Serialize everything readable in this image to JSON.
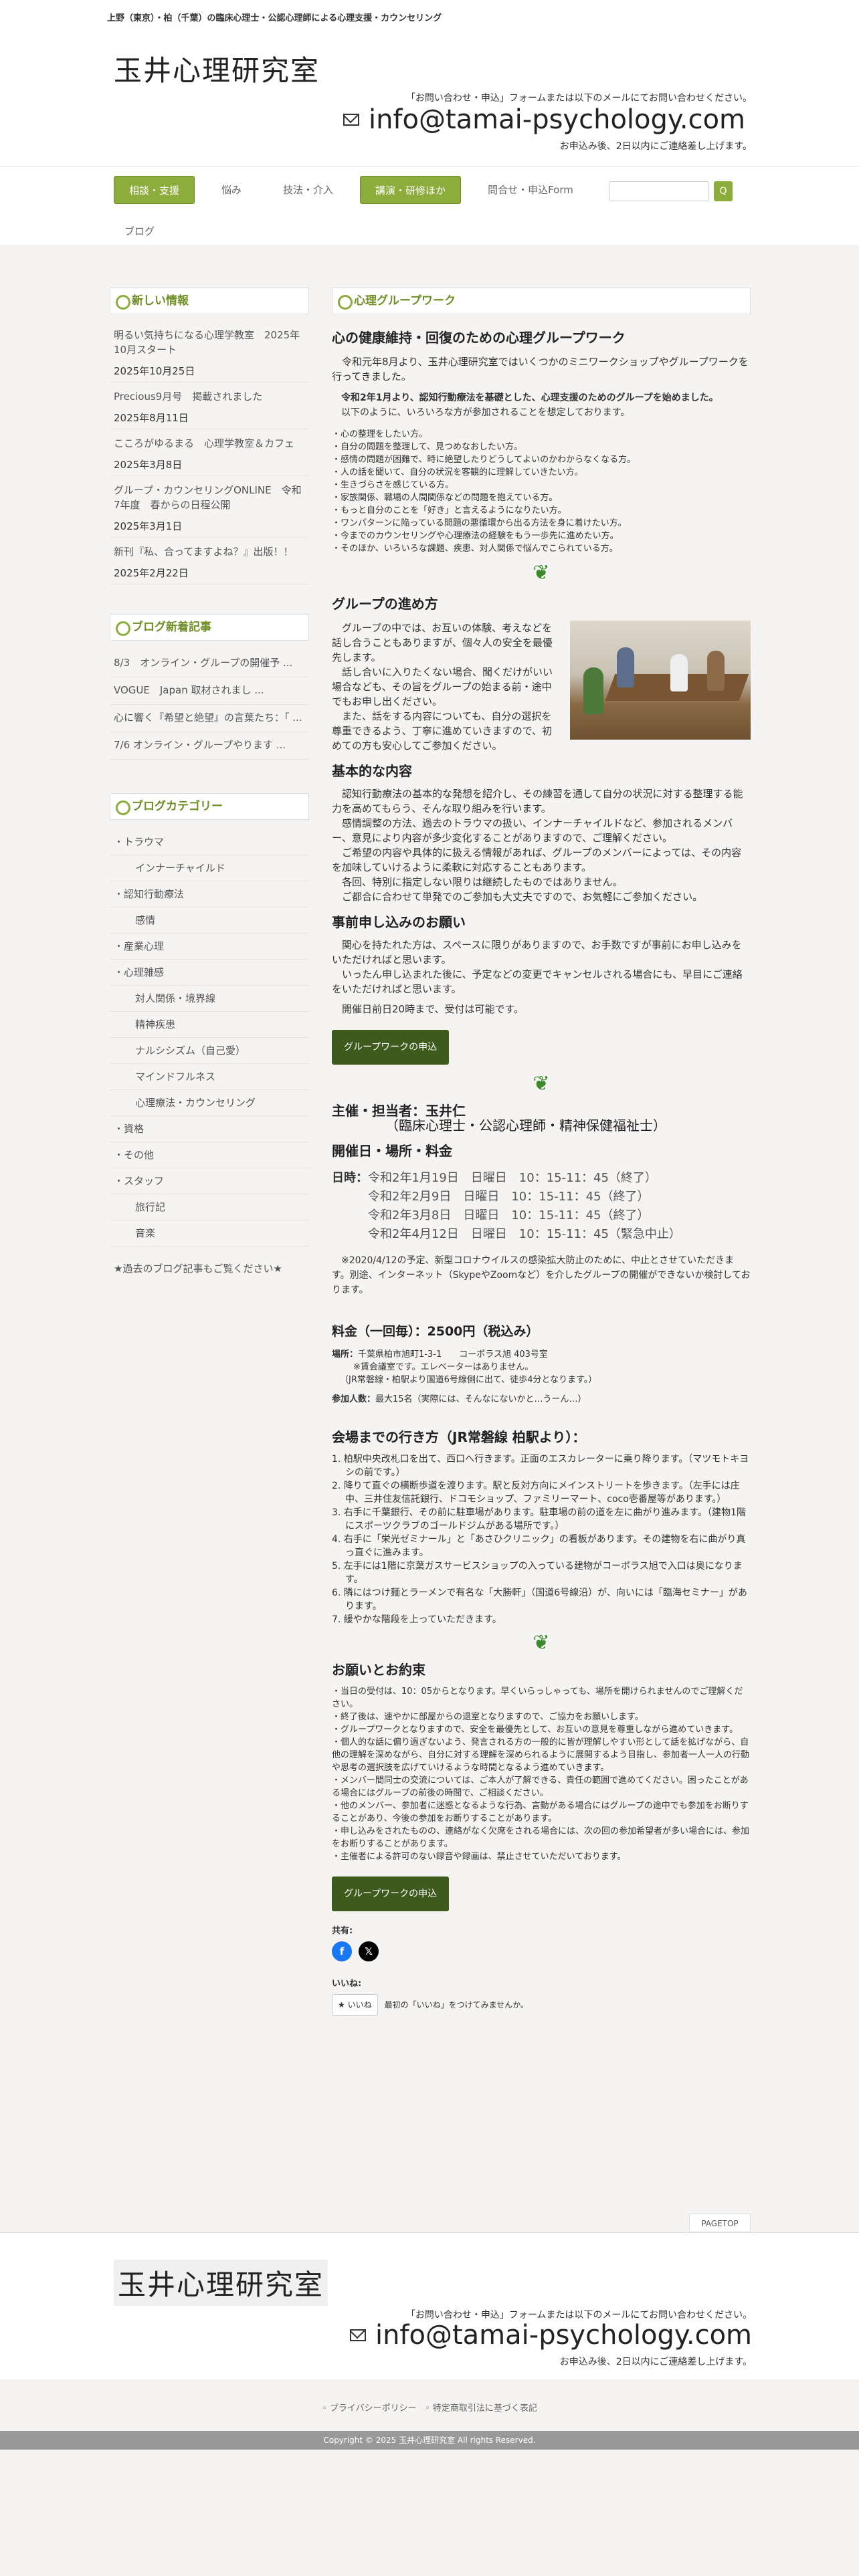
{
  "topbar": {
    "text": "上野（東京）・柏（千葉）の臨床心理士・公認心理師による心理支援・カウンセリング"
  },
  "header": {
    "logo": "玉井心理研究室",
    "contact_note": "「お問い合わせ・申込」フォームまたは以下のメールにてお問い合わせください。",
    "email": "info@tamai-psychology.com",
    "reply_note": "お申込み後、2日以内にご連絡差し上げます。"
  },
  "nav": {
    "items": [
      "相談・支援",
      "悩み",
      "技法・介入",
      "講演・研修ほか",
      "問合せ・申込Form"
    ],
    "blog": "ブログ",
    "search_button": "Q"
  },
  "sidebar": {
    "news_title": "新しい情報",
    "news": [
      {
        "text": "明るい気持ちになる心理学教室　2025年10月スタート",
        "date": "2025年10月25日"
      },
      {
        "text": "Precious9月号　掲載されました",
        "date": "2025年8月11日"
      },
      {
        "text": "こころがゆるまる　心理学教室＆カフェ",
        "date": "2025年3月8日"
      },
      {
        "text": "グループ・カウンセリングONLINE　令和7年度　春からの日程公開",
        "date": "2025年3月1日"
      },
      {
        "text": "新刊『私、合ってますよね？』出版！！",
        "date": "2025年2月22日"
      }
    ],
    "blog_title": "ブログ新着記事",
    "blog_posts": [
      "8/3　オンライン・グループの開催予 ...",
      "VOGUE　Japan 取材されまし ...",
      "心に響く『希望と絶望』の言葉たち：「 ...",
      "7/6 オンライン・グループやります ..."
    ],
    "cat_title": "ブログカテゴリー",
    "categories": [
      {
        "label": "・トラウマ",
        "sub": false
      },
      {
        "label": "インナーチャイルド",
        "sub": true
      },
      {
        "label": "・認知行動療法",
        "sub": false
      },
      {
        "label": "感情",
        "sub": true
      },
      {
        "label": "・産業心理",
        "sub": false
      },
      {
        "label": "・心理雑感",
        "sub": false
      },
      {
        "label": "対人関係・境界線",
        "sub": true
      },
      {
        "label": "精神疾患",
        "sub": true
      },
      {
        "label": "ナルシシズム（自己愛）",
        "sub": true
      },
      {
        "label": "マインドフルネス",
        "sub": true
      },
      {
        "label": "心理療法・カウンセリング",
        "sub": true
      },
      {
        "label": "・資格",
        "sub": false
      },
      {
        "label": "・その他",
        "sub": false
      },
      {
        "label": "・スタッフ",
        "sub": false
      },
      {
        "label": "旅行記",
        "sub": true
      },
      {
        "label": "音楽",
        "sub": true
      }
    ],
    "past_link": "★過去のブログ記事もご覧ください★"
  },
  "main": {
    "title": "心理グループワーク",
    "h1": "心の健康維持・回復のための心理グループワーク",
    "intro": "令和元年8月より、玉井心理研究室ではいくつかのミニワークショップやグループワークを行ってきました。",
    "intro_bold": "令和2年1月より、認知行動療法を基礎とした、心理支援のためのグループを始めました。",
    "intro2": "以下のように、いろいろな方が参加されることを想定しております。",
    "bullets": [
      "・心の整理をしたい方。",
      "・自分の問題を整理して、見つめなおしたい方。",
      "・感情の問題が困難で、時に絶望したりどうしてよいのかわからなくなる方。",
      "・人の話を聞いて、自分の状況を客観的に理解していきたい方。",
      "・生きづらさを感じている方。",
      "・家族関係、職場の人間関係などの問題を抱えている方。",
      "・もっと自分のことを「好き」と言えるようになりたい方。",
      "・ワンパターンに陥っている問題の悪循環から出る方法を身に着けたい方。",
      "・今までのカウンセリングや心理療法の経験をもう一歩先に進めたい方。",
      "・そのほか、いろいろな課題、疾患、対人関係で悩んでこられている方。"
    ],
    "h_progress": "グループの進め方",
    "progress": [
      "グループの中では、お互いの体験、考えなどを話し合うこともありますが、個々人の安全を最優先します。",
      "話し合いに入りたくない場合、聞くだけがいい場合なども、その旨をグループの始まる前・途中でもお申し出ください。",
      "また、話をする内容についても、自分の選択を尊重できるよう、丁寧に進めていきますので、初めての方も安心してご参加ください。"
    ],
    "h_content": "基本的な内容",
    "content": [
      "認知行動療法の基本的な発想を紹介し、その練習を通して自分の状況に対する整理する能力を高めてもらう、そんな取り組みを行います。",
      "感情調整の方法、過去のトラウマの扱い、インナーチャイルドなど、参加されるメンバー、意見により内容が多少変化することがありますので、ご理解ください。",
      "ご希望の内容や具体的に扱える情報があれば、グループのメンバーによっては、その内容を加味していけるように柔軟に対応することもあります。",
      "各回、特別に指定しない限りは継続したものではありません。",
      "ご都合に合わせて単発でのご参加も大丈夫ですので、お気軽にご参加ください。"
    ],
    "h_apply": "事前申し込みのお願い",
    "apply": [
      "関心を持たれた方は、スペースに限りがありますので、お手数ですが事前にお申し込みをいただければと思います。",
      "いったん申し込まれた後に、予定などの変更でキャンセルされる場合にも、早目にご連絡をいただければと思います。",
      "開催日前日20時まで、受付は可能です。"
    ],
    "apply_button": "グループワークの申込",
    "host": "主催・担当者：玉井仁",
    "host2": "（臨床心理士・公認心理師・精神保健福祉士）",
    "h_schedule": "開催日・場所・料金",
    "schedule_label": "日時：",
    "schedule": [
      "令和2年1月19日　日曜日　10：15-11：45（終了）",
      "令和2年2月9日　日曜日　10：15-11：45（終了）",
      "令和2年3月8日　日曜日　10：15-11：45（終了）",
      "令和2年4月12日　日曜日　10：15-11：45（緊急中止）"
    ],
    "covid_note": "※2020/4/12の予定、新型コロナウイルスの感染拡大防止のために、中止とさせていただきます。別途、インターネット（SkypeやZoomなど）を介したグループの開催ができないか検討しております。",
    "fee": "料金（一回毎）：2500円（税込み）",
    "place_label": "場所：",
    "place": "千葉県柏市旭町1-3-1　　コーポラス旭 403号室",
    "place_note1": "※賃会議室です。エレベーターはありません。",
    "place_note2": "（JR常磐線・柏駅より国道6号線側に出て、徒歩4分となります。）",
    "capacity_label": "参加人数：",
    "capacity": "最大15名（実際には、そんなにないかと…うーん…）",
    "h_route": "会場までの行き方（JR常磐線 柏駅より）：",
    "route": [
      "1. 柏駅中央改札口を出て、西口へ行きます。正面のエスカレーターに乗り降ります。（マツモトキヨシの前です。）",
      "2. 降りて直ぐの横断歩道を渡ります。駅と反対方向にメインストリートを歩きます。（左手には庄中、三井住友信託銀行、ドコモショップ、ファミリーマート、coco壱番屋等があります。）",
      "3. 右手に千葉銀行、その前に駐車場があります。駐車場の前の道を左に曲がり進みます。（建物1階にスポーツクラブのゴールドジムがある場所です。）",
      "4. 右手に「栄光ゼミナール」と「あさひクリニック」の看板があります。その建物を右に曲がり真っ直ぐに進みます。",
      "5. 左手には1階に京葉ガスサービスショップの入っている建物がコーポラス旭で入口は奥になります。",
      "6. 隣にはつけ麺とラーメンで有名な「大勝軒」（国道6号線沿）が、向いには「臨海セミナー」があります。",
      "7. 緩やかな階段を上っていただきます。"
    ],
    "h_request": "お願いとお約束",
    "requests": [
      "・当日の受付は、10：05からとなります。早くいらっしゃっても、場所を開けられませんのでご理解ください。",
      "・終了後は、速やかに部屋からの退室となりますので、ご協力をお願いします。",
      "・グループワークとなりますので、安全を最優先として、お互いの意見を尊重しながら進めていきます。",
      "・個人的な話に偏り過ぎないよう、発言される方の一般的に皆が理解しやすい形として話を拡げながら、自他の理解を深めながら、自分に対する理解を深められるように展開するよう目指し、参加者一人一人の行動や思考の選択肢を広げていけるような時間となるよう進めていきます。",
      "・メンバー間同士の交流については、ご本人が了解できる、責任の範囲で進めてください。困ったことがある場合にはグループの前後の時間で、ご相談ください。",
      "・他のメンバー、参加者に迷惑となるような行為、言動がある場合にはグループの途中でも参加をお断りすることがあり、今後の参加をお断りすることがあります。",
      "・申し込みをされたものの、連絡がなく欠席をされる場合には、次の回の参加希望者が多い場合には、参加をお断りすることがあります。",
      "・主催者による許可のない録音や録画は、禁止させていただいております。"
    ],
    "share_label": "共有:",
    "like_label": "いいね:",
    "like_button": "いいね",
    "like_text": "最初の「いいね」をつけてみませんか。"
  },
  "pagetop": "PAGETOP",
  "footer": {
    "logo": "玉井心理研究室",
    "contact_note": "「お問い合わせ・申込」フォームまたは以下のメールにてお問い合わせください。",
    "email": "info@tamai-psychology.com",
    "reply_note": "お申込み後、2日以内にご連絡差し上げます。",
    "links": [
      "プライバシーポリシー",
      "特定商取引法に基づく表記"
    ],
    "copyright": "Copyright © 2025 玉井心理研究室 All rights Reserved."
  },
  "colors": {
    "accent": "#8cac3c",
    "button_dark": "#3f5a1d",
    "title_green": "#6e8f26"
  }
}
